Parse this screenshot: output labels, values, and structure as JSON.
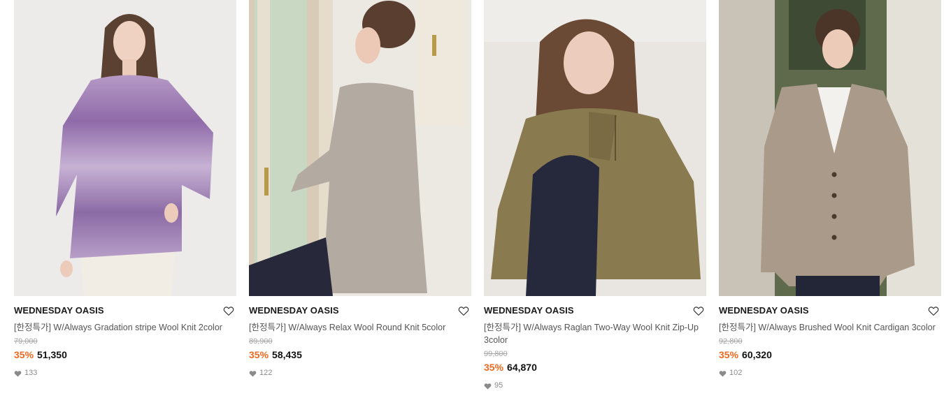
{
  "colors": {
    "discount": "#f2681c",
    "price": "#111111",
    "original_price": "#a5a5a5",
    "brand": "#1a1a1a"
  },
  "products": [
    {
      "brand": "WEDNESDAY OASIS",
      "name": "[한정특가] W/Always Gradation stripe Wool Knit 2color",
      "original_price": "79,000",
      "discount": "35%",
      "price": "51,350",
      "likes": "133",
      "image_desc_icon": "purple-gradation-knit-photo"
    },
    {
      "brand": "WEDNESDAY OASIS",
      "name": "[한정특가] W/Always Relax Wool Round Knit 5color",
      "original_price": "89,900",
      "discount": "35%",
      "price": "58,435",
      "likes": "122",
      "image_desc_icon": "grey-round-knit-photo"
    },
    {
      "brand": "WEDNESDAY OASIS",
      "name": "[한정특가] W/Always Raglan Two-Way Wool Knit Zip-Up 3color",
      "original_price": "99,800",
      "discount": "35%",
      "price": "64,870",
      "likes": "95",
      "image_desc_icon": "khaki-zipup-knit-photo"
    },
    {
      "brand": "WEDNESDAY OASIS",
      "name": "[한정특가] W/Always Brushed Wool Knit Cardigan 3color",
      "original_price": "92,800",
      "discount": "35%",
      "price": "60,320",
      "likes": "102",
      "image_desc_icon": "beige-cardigan-photo"
    }
  ]
}
